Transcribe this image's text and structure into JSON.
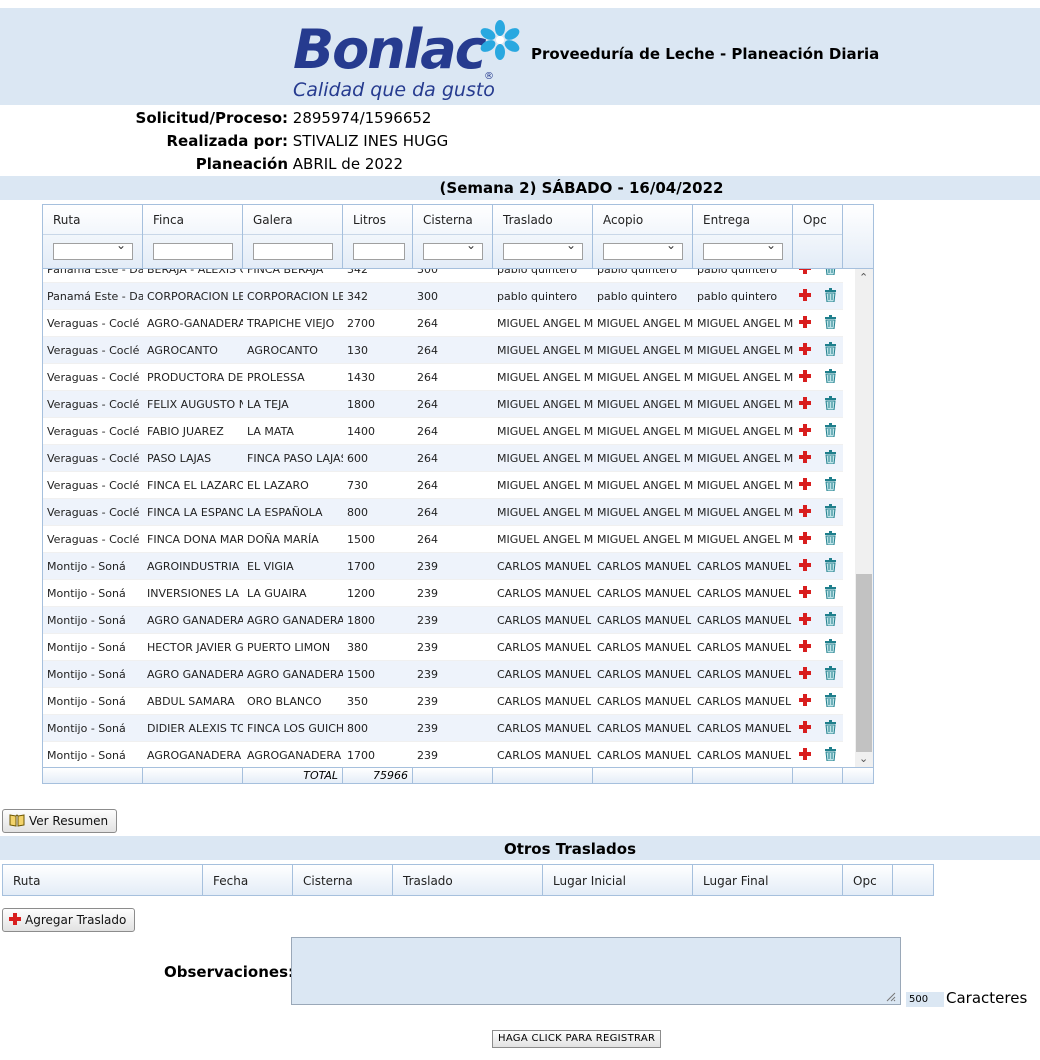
{
  "header": {
    "logo_text": "Bonlac",
    "logo_slogan": "Calidad que da gusto",
    "title": "Proveeduría de Leche - Planeación Diaria"
  },
  "info": {
    "solicitud_label": "Solicitud/Proceso:",
    "solicitud_value": "2895974/1596652",
    "realizada_label": "Realizada por:",
    "realizada_value": "STIVALIZ INES HUGG",
    "planeacion_label": "Planeación",
    "planeacion_value": "ABRIL de 2022"
  },
  "week_title": "(Semana 2) SÁBADO - 16/04/2022",
  "grid": {
    "columns": [
      "Ruta",
      "Finca",
      "Galera",
      "Litros",
      "Cisterna",
      "Traslado",
      "Acopio",
      "Entrega",
      "Opc"
    ],
    "rows": [
      [
        "Panamá Este - Darién",
        "BERAJA - ALEXIS GARCIA",
        "FINCA BERAJA",
        "342",
        "300",
        "pablo quintero",
        "pablo quintero",
        "pablo quintero"
      ],
      [
        "Panamá Este - Darién",
        "CORPORACION LECHERA",
        "CORPORACION LECHERA",
        "342",
        "300",
        "pablo quintero",
        "pablo quintero",
        "pablo quintero"
      ],
      [
        "Veraguas - Coclé",
        "AGRO-GANADERA ZAPATA",
        "TRAPICHE VIEJO",
        "2700",
        "264",
        "MIGUEL ANGEL MORALES",
        "MIGUEL ANGEL MORALES",
        "MIGUEL ANGEL MORALES"
      ],
      [
        "Veraguas - Coclé",
        "AGROCANTO",
        "AGROCANTO",
        "130",
        "264",
        "MIGUEL ANGEL MORALES",
        "MIGUEL ANGEL MORALES",
        "MIGUEL ANGEL MORALES"
      ],
      [
        "Veraguas - Coclé",
        "PRODUCTORA DE LECHE",
        "PROLESSA",
        "1430",
        "264",
        "MIGUEL ANGEL MORALES",
        "MIGUEL ANGEL MORALES",
        "MIGUEL ANGEL MORALES"
      ],
      [
        "Veraguas - Coclé",
        "FELIX AUGUSTO NUÑEZ",
        "LA TEJA",
        "1800",
        "264",
        "MIGUEL ANGEL MORALES",
        "MIGUEL ANGEL MORALES",
        "MIGUEL ANGEL MORALES"
      ],
      [
        "Veraguas - Coclé",
        "FABIO JUAREZ",
        "LA MATA",
        "1400",
        "264",
        "MIGUEL ANGEL MORALES",
        "MIGUEL ANGEL MORALES",
        "MIGUEL ANGEL MORALES"
      ],
      [
        "Veraguas - Coclé",
        "PASO LAJAS",
        "FINCA PASO LAJAS",
        "600",
        "264",
        "MIGUEL ANGEL MORALES",
        "MIGUEL ANGEL MORALES",
        "MIGUEL ANGEL MORALES"
      ],
      [
        "Veraguas - Coclé",
        "FINCA EL LAZARO",
        "EL LAZARO",
        "730",
        "264",
        "MIGUEL ANGEL MORALES",
        "MIGUEL ANGEL MORALES",
        "MIGUEL ANGEL MORALES"
      ],
      [
        "Veraguas - Coclé",
        "FINCA LA ESPANOLA",
        "LA ESPAÑOLA",
        "800",
        "264",
        "MIGUEL ANGEL MORALES",
        "MIGUEL ANGEL MORALES",
        "MIGUEL ANGEL MORALES"
      ],
      [
        "Veraguas - Coclé",
        "FINCA DONA MARIA",
        "DOÑA MARÍA",
        "1500",
        "264",
        "MIGUEL ANGEL MORALES",
        "MIGUEL ANGEL MORALES",
        "MIGUEL ANGEL MORALES"
      ],
      [
        "Montijo - Soná",
        "AGROINDUSTRIA FELIX",
        "EL VIGIA",
        "1700",
        "239",
        "CARLOS MANUEL CEDEÑO",
        "CARLOS MANUEL CEDEÑO",
        "CARLOS MANUEL CEDEÑO"
      ],
      [
        "Montijo - Soná",
        "INVERSIONES LA GUAIRA",
        "LA GUAIRA",
        "1200",
        "239",
        "CARLOS MANUEL CEDEÑO",
        "CARLOS MANUEL CEDEÑO",
        "CARLOS MANUEL CEDEÑO"
      ],
      [
        "Montijo - Soná",
        "AGRO GANADERA DEL",
        "AGRO GANADERA DEL",
        "1800",
        "239",
        "CARLOS MANUEL CEDEÑO",
        "CARLOS MANUEL CEDEÑO",
        "CARLOS MANUEL CEDEÑO"
      ],
      [
        "Montijo - Soná",
        "HECTOR JAVIER GONZALEZ",
        "PUERTO LIMON",
        "380",
        "239",
        "CARLOS MANUEL CEDEÑO",
        "CARLOS MANUEL CEDEÑO",
        "CARLOS MANUEL CEDEÑO"
      ],
      [
        "Montijo - Soná",
        "AGRO GANADERA LA",
        "AGRO GANADERA LA",
        "1500",
        "239",
        "CARLOS MANUEL CEDEÑO",
        "CARLOS MANUEL CEDEÑO",
        "CARLOS MANUEL CEDEÑO"
      ],
      [
        "Montijo - Soná",
        "ABDUL SAMARA",
        "ORO BLANCO",
        "350",
        "239",
        "CARLOS MANUEL CEDEÑO",
        "CARLOS MANUEL CEDEÑO",
        "CARLOS MANUEL CEDEÑO"
      ],
      [
        "Montijo - Soná",
        "DIDIER ALEXIS TORRES",
        "FINCA LOS GUICHICOS",
        "800",
        "239",
        "CARLOS MANUEL CEDEÑO",
        "CARLOS MANUEL CEDEÑO",
        "CARLOS MANUEL CEDEÑO"
      ],
      [
        "Montijo - Soná",
        "AGROGANADERA DON",
        "AGROGANADERA DON",
        "1700",
        "239",
        "CARLOS MANUEL CEDEÑO",
        "CARLOS MANUEL CEDEÑO",
        "CARLOS MANUEL CEDEÑO"
      ]
    ],
    "total_label": "TOTAL",
    "total_value": "75966"
  },
  "buttons": {
    "ver_resumen": "Ver Resumen",
    "agregar_traslado": "Agregar Traslado",
    "registrar": "HAGA CLICK PARA REGISTRAR"
  },
  "otros": {
    "title": "Otros Traslados",
    "columns": [
      "Ruta",
      "Fecha",
      "Cisterna",
      "Traslado",
      "Lugar Inicial",
      "Lugar Final",
      "Opc"
    ]
  },
  "observaciones": {
    "label": "Observaciones:",
    "value": "",
    "chars_count": "500",
    "chars_label": "Caracteres"
  },
  "colors": {
    "brand_blue": "#263b8f",
    "flower_blue": "#29a8e0",
    "header_bg": "#dbe7f3",
    "add_red": "#d81e1e",
    "delete_teal": "#1f7f8c"
  },
  "icons": [
    "bonlac-flower-logo",
    "book-icon",
    "add-icon",
    "delete-icon",
    "chevron-down-icon",
    "resize-grip-icon"
  ]
}
